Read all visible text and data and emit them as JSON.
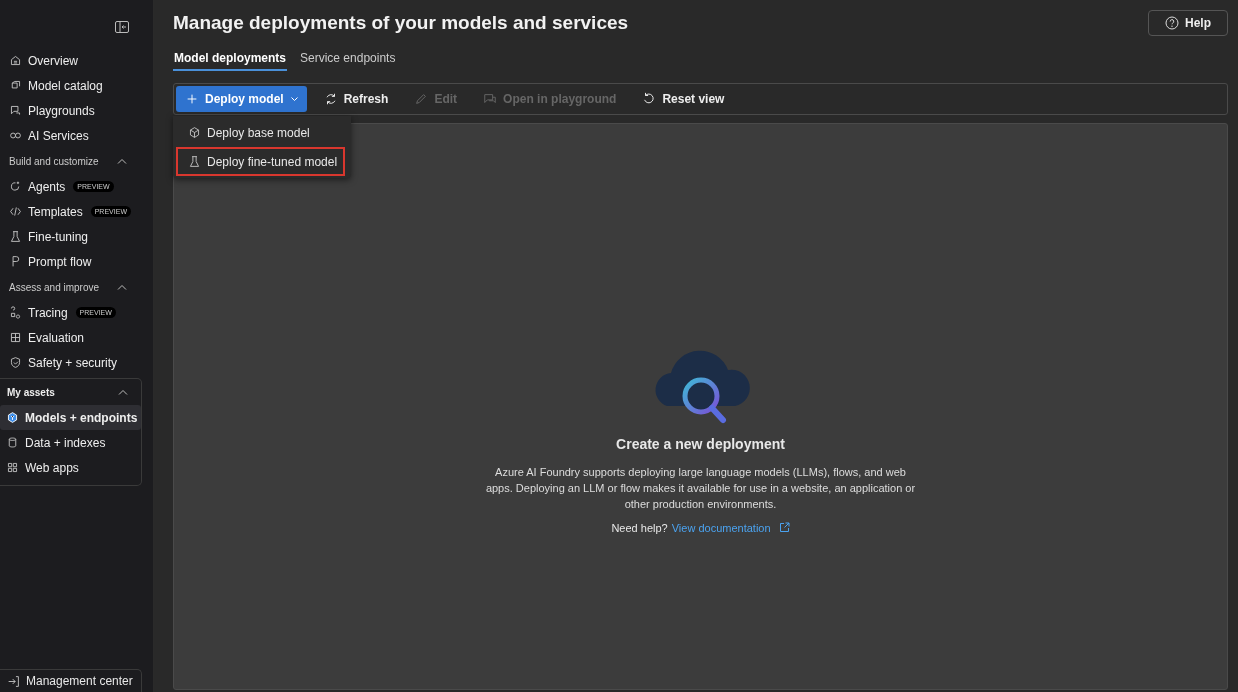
{
  "sidebar": {
    "top_items": [
      {
        "label": "Overview",
        "selected": false
      },
      {
        "label": "Model catalog",
        "selected": false
      },
      {
        "label": "Playgrounds",
        "selected": false
      },
      {
        "label": "AI Services",
        "selected": false
      }
    ],
    "groups": [
      {
        "title": "Build and customize",
        "expanded": true,
        "boxed": false,
        "items": [
          {
            "label": "Agents",
            "badge": "PREVIEW",
            "selected": false
          },
          {
            "label": "Templates",
            "badge": "PREVIEW",
            "selected": false
          },
          {
            "label": "Fine-tuning",
            "selected": false
          },
          {
            "label": "Prompt flow",
            "selected": false
          }
        ]
      },
      {
        "title": "Assess and improve",
        "expanded": true,
        "boxed": false,
        "items": [
          {
            "label": "Tracing",
            "badge": "PREVIEW",
            "selected": false
          },
          {
            "label": "Evaluation",
            "selected": false
          },
          {
            "label": "Safety + security",
            "selected": false
          }
        ]
      },
      {
        "title": "My assets",
        "expanded": true,
        "boxed": true,
        "items": [
          {
            "label": "Models + endpoints",
            "selected": true
          },
          {
            "label": "Data + indexes",
            "selected": false
          },
          {
            "label": "Web apps",
            "selected": false
          }
        ]
      }
    ],
    "footer": {
      "label": "Management center"
    }
  },
  "page": {
    "title": "Manage deployments of your models and services",
    "help_button": "Help",
    "tabs": [
      {
        "label": "Model deployments",
        "selected": true
      },
      {
        "label": "Service endpoints",
        "selected": false
      }
    ],
    "toolbar": [
      {
        "label": "Deploy model",
        "kind": "primary",
        "disabled": false
      },
      {
        "label": "Refresh",
        "kind": "plain",
        "disabled": false
      },
      {
        "label": "Edit",
        "kind": "plain",
        "disabled": true
      },
      {
        "label": "Open in playground",
        "kind": "plain",
        "disabled": true
      },
      {
        "label": "Reset view",
        "kind": "plain",
        "disabled": false
      }
    ],
    "menu": [
      {
        "label": "Deploy base model",
        "highlighted": false
      },
      {
        "label": "Deploy fine-tuned model",
        "highlighted": true
      }
    ],
    "empty_state": {
      "title": "Create a new deployment",
      "description": "Azure AI Foundry supports deploying large language models (LLMs), flows, and web apps. Deploying an LLM or flow makes it available for use in a website, an application or other production environments.",
      "help_prefix": "Need help?",
      "link": "View documentation"
    }
  }
}
